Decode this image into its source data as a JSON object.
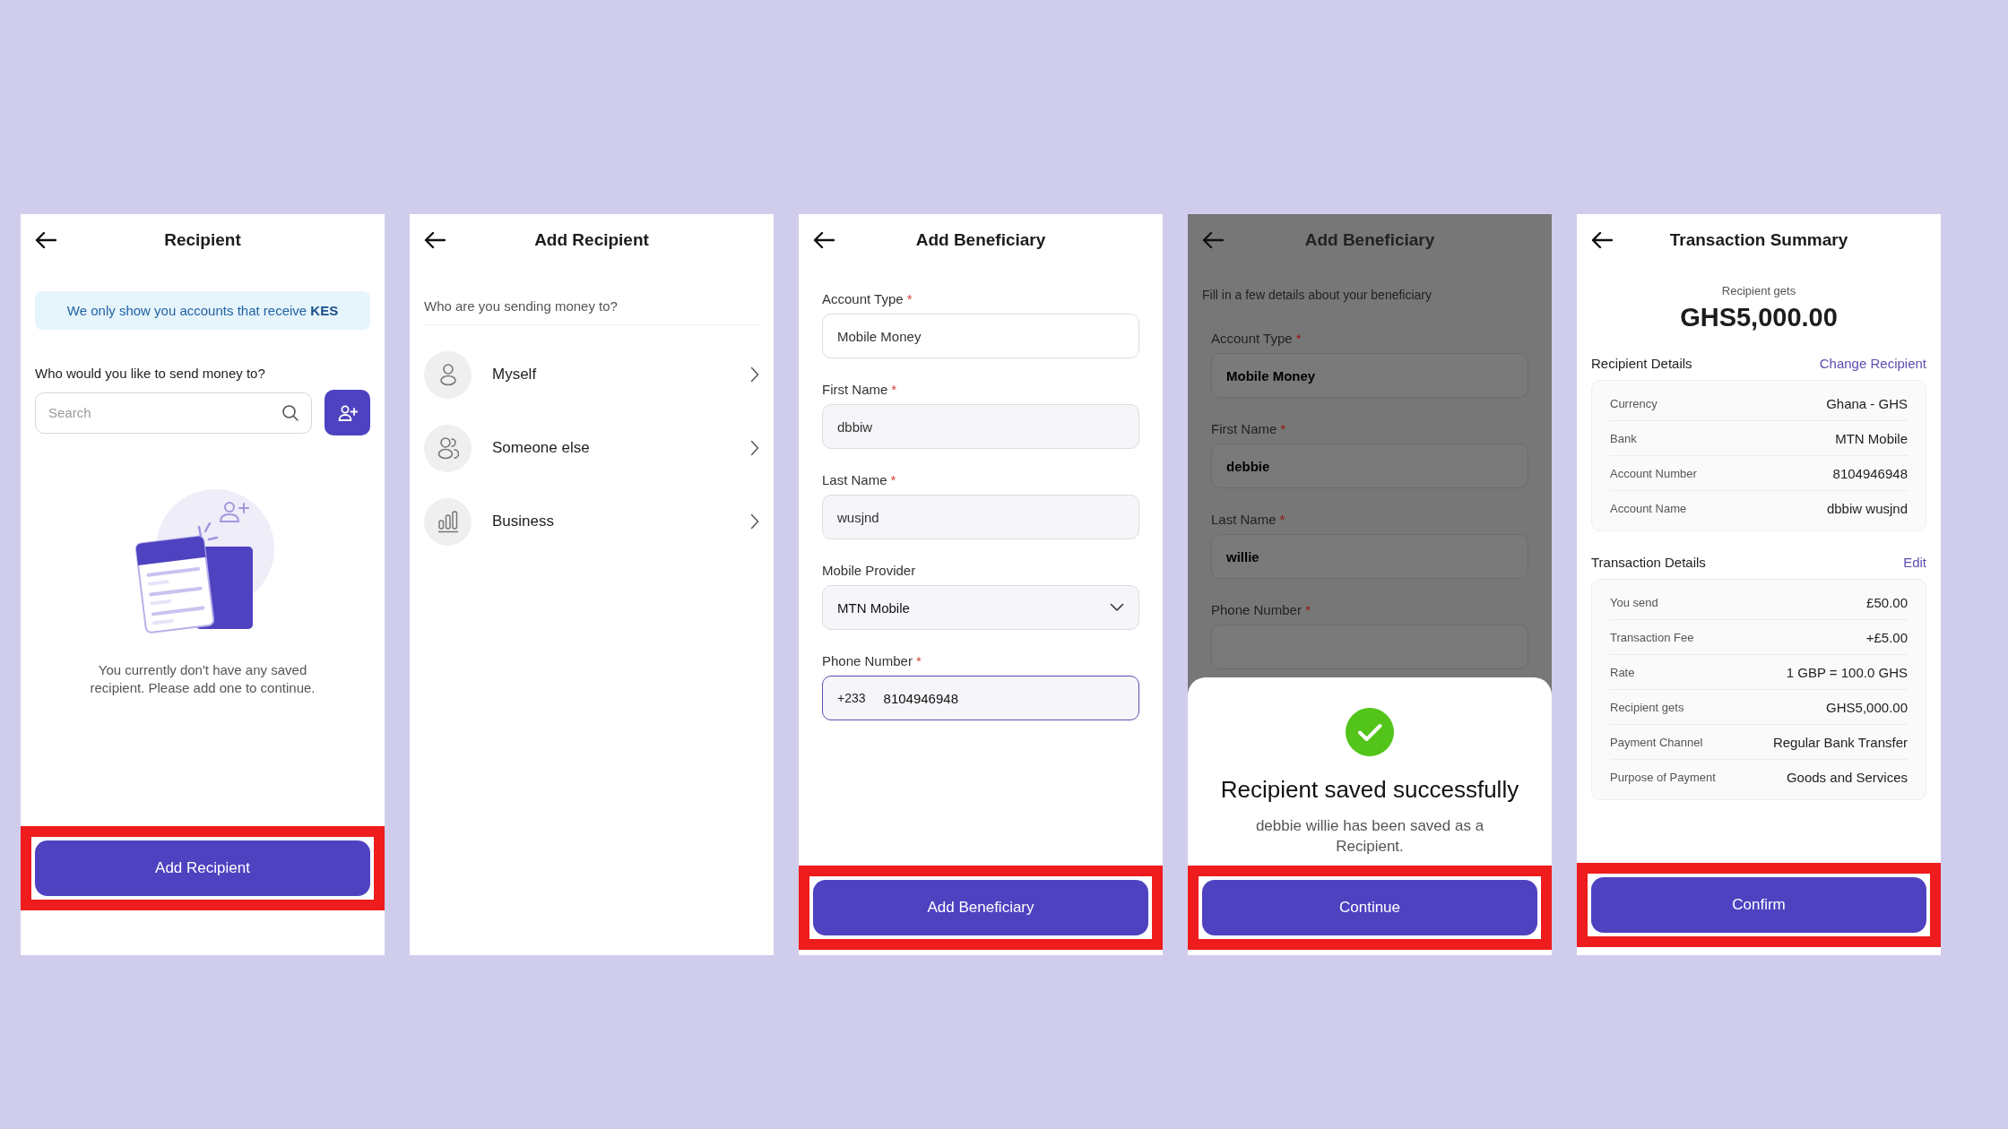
{
  "screens": [
    {
      "kind": "recipient",
      "title": "Recipient",
      "notice": "We only show you accounts that receive **KES**",
      "prompt": "Who would you like to send money to?",
      "search": {
        "placeholder": "Search"
      },
      "empty_text": "You currently don't have any saved recipient. Please add one to continue.",
      "button": {
        "label": "Add Recipient",
        "highlighted": true
      }
    },
    {
      "kind": "options",
      "title": "Add Recipient",
      "prompt": "Who are you sending money to?",
      "options": [
        {
          "kind": "person",
          "label": "Myself"
        },
        {
          "kind": "people",
          "label": "Someone else"
        },
        {
          "kind": "business",
          "label": "Business"
        }
      ]
    },
    {
      "kind": "form",
      "title": "Add Beneficiary",
      "dimmed": false,
      "fields": [
        {
          "kind": "text",
          "label": "Account Type",
          "required_mark": "*",
          "value": "Mobile Money",
          "focused": false
        },
        {
          "kind": "text",
          "label": "First Name",
          "required_mark": "*",
          "value": "dbbiw",
          "focused": false
        },
        {
          "kind": "text",
          "label": "Last Name",
          "required_mark": "*",
          "value": "wusjnd",
          "focused": false
        },
        {
          "kind": "select",
          "label": "Mobile Provider",
          "value": "MTN Mobile",
          "focused": false
        },
        {
          "kind": "phone",
          "label": "Phone Number",
          "required_mark": "*",
          "prefix": "+233",
          "value": "8104946948",
          "focused": true
        }
      ],
      "button": {
        "label": "Add Beneficiary",
        "highlighted": true
      }
    },
    {
      "kind": "form",
      "title": "Add Beneficiary",
      "dimmed": true,
      "subtitle": "Fill in a few details about your beneficiary",
      "fields": [
        {
          "kind": "text",
          "label": "Account Type",
          "required_mark": "*",
          "value": "Mobile Money"
        },
        {
          "kind": "text",
          "label": "First Name",
          "required_mark": "*",
          "value": "debbie"
        },
        {
          "kind": "text",
          "label": "Last Name",
          "required_mark": "*",
          "value": "willie"
        },
        {
          "kind": "text",
          "label": "Phone Number",
          "required_mark": "*"
        }
      ],
      "sheet": {
        "title": "Recipient saved successfully",
        "message": "debbie willie has been saved as a Recipient.",
        "button": {
          "label": "Continue",
          "highlighted": true
        }
      }
    },
    {
      "kind": "summary",
      "title": "Transaction Summary",
      "amount_label": "Recipient gets",
      "amount": "GHS5,000.00",
      "sections": [
        {
          "title": "Recipient Details",
          "action": "Change Recipient",
          "rows": [
            {
              "label": "Currency",
              "value": "Ghana - GHS"
            },
            {
              "label": "Bank",
              "value": "MTN Mobile"
            },
            {
              "label": "Account Number",
              "value": "8104946948"
            },
            {
              "label": "Account Name",
              "value": "dbbiw wusjnd"
            }
          ]
        },
        {
          "title": "Transaction Details",
          "action": "Edit",
          "rows": [
            {
              "label": "You send",
              "value": "£50.00"
            },
            {
              "label": "Transaction Fee",
              "value": "+£5.00"
            },
            {
              "label": "Rate",
              "value": "1 GBP = 100.0 GHS"
            },
            {
              "label": "Recipient gets",
              "value": "GHS5,000.00"
            },
            {
              "label": "Payment Channel",
              "value": "Regular Bank Transfer"
            },
            {
              "label": "Purpose of Payment",
              "value": "Goods and Services"
            }
          ]
        }
      ],
      "button": {
        "label": "Confirm",
        "highlighted": true
      }
    }
  ]
}
